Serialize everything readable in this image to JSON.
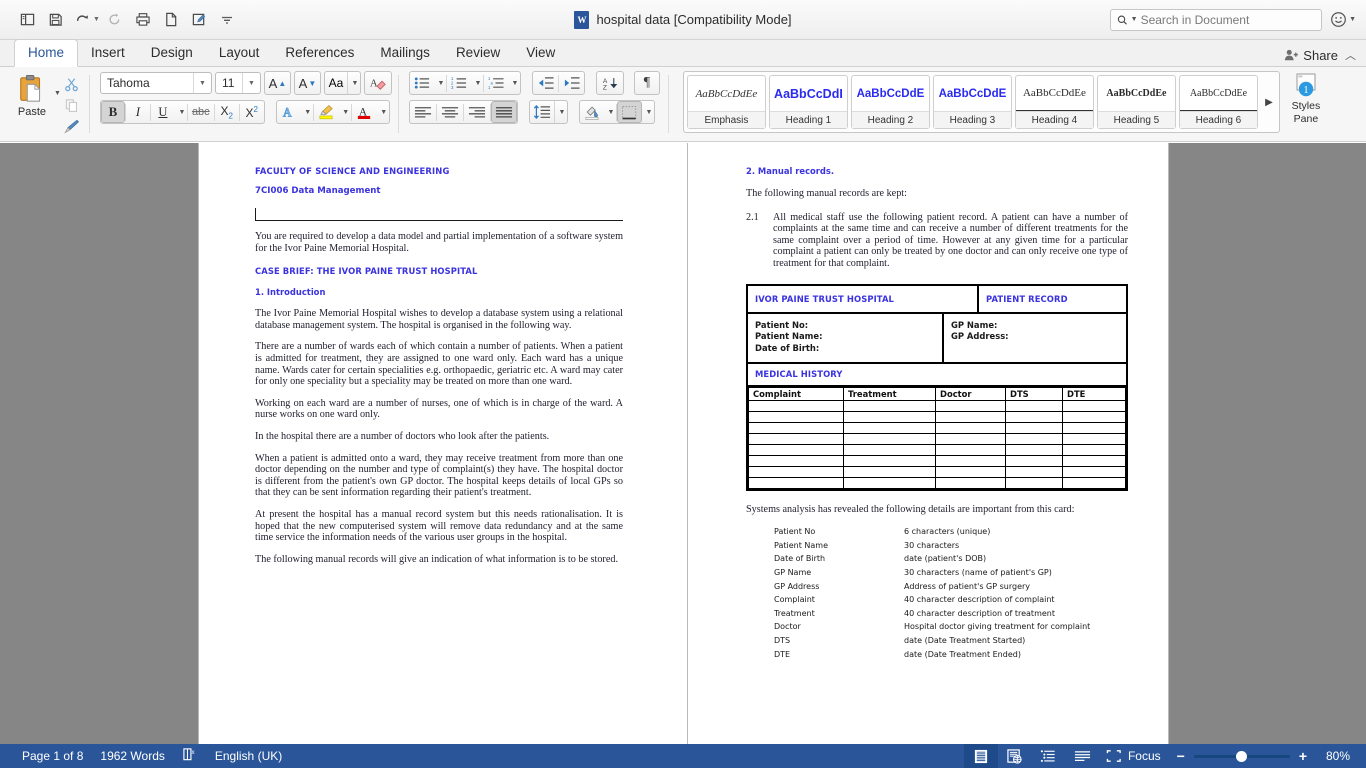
{
  "titlebar": {
    "document_title": "hospital data [Compatibility Mode]",
    "quick_access": [
      {
        "name": "sidebar-toggle",
        "icon": "panel-icon"
      },
      {
        "name": "save",
        "icon": "save-icon"
      },
      {
        "name": "undo",
        "icon": "undo-icon"
      },
      {
        "name": "redo",
        "icon": "redo-icon"
      },
      {
        "name": "print",
        "icon": "print-icon"
      },
      {
        "name": "new-document",
        "icon": "page-icon"
      },
      {
        "name": "edit",
        "icon": "pencil-page-icon"
      },
      {
        "name": "customize",
        "icon": "chevron-down-icon"
      }
    ],
    "search_placeholder": "Search in Document",
    "search_value": "",
    "feedback_icon": "smiley-icon"
  },
  "tabs": [
    {
      "label": "Home",
      "active": true
    },
    {
      "label": "Insert",
      "active": false
    },
    {
      "label": "Design",
      "active": false
    },
    {
      "label": "Layout",
      "active": false
    },
    {
      "label": "References",
      "active": false
    },
    {
      "label": "Mailings",
      "active": false
    },
    {
      "label": "Review",
      "active": false
    },
    {
      "label": "View",
      "active": false
    }
  ],
  "share": {
    "label": "Share",
    "icon": "person-plus-icon",
    "collapse_icon": "chevron-up-icon"
  },
  "ribbon": {
    "clipboard": {
      "paste_label": "Paste",
      "cut_name": "cut-icon",
      "copy_name": "copy-icon",
      "format_painter_name": "format-painter-icon"
    },
    "font": {
      "font_name": "Tahoma",
      "font_size": "11",
      "grow_font": "A",
      "shrink_font": "A",
      "change_case": "Aa",
      "clear_formatting": "clear-formatting-icon",
      "bold": "B",
      "italic": "I",
      "underline": "U",
      "strikethrough": "abc",
      "subscript": "X",
      "superscript": "X",
      "text_effects": "A",
      "highlight": "highlight-icon",
      "font_color": "A",
      "bold_active": true
    },
    "paragraph": {
      "bullets": "bullets-icon",
      "numbering": "numbering-icon",
      "multilevel": "multilevel-list-icon",
      "decrease_indent": "decrease-indent-icon",
      "increase_indent": "increase-indent-icon",
      "sort": "sort-icon",
      "show_marks": "¶",
      "align_left": "align-left-icon",
      "align_center": "align-center-icon",
      "align_right": "align-right-icon",
      "align_justify": "align-justify-icon",
      "line_spacing": "line-spacing-icon",
      "shading": "shading-icon",
      "borders": "borders-icon",
      "justify_active": true
    },
    "styles": {
      "items": [
        {
          "name": "Emphasis",
          "preview": "AaBbCcDdEe",
          "style": "emphasis"
        },
        {
          "name": "Heading 1",
          "preview": "AaBbCcDdI",
          "style": "h1"
        },
        {
          "name": "Heading 2",
          "preview": "AaBbCcDdE",
          "style": "h2"
        },
        {
          "name": "Heading 3",
          "preview": "AaBbCcDdE",
          "style": "h3"
        },
        {
          "name": "Heading 4",
          "preview": "AaBbCcDdEe",
          "style": "h4"
        },
        {
          "name": "Heading 5",
          "preview": "AaBbCcDdEe",
          "style": "h5"
        },
        {
          "name": "Heading 6",
          "preview": "AaBbCcDdEe",
          "style": "h6"
        }
      ],
      "more_icon": "chevron-right-icon",
      "pane_label_line1": "Styles",
      "pane_label_line2": "Pane",
      "pane_badge": "1"
    }
  },
  "document": {
    "page1": {
      "faculty": "FACULTY OF SCIENCE AND ENGINEERING",
      "module": "7CI006 Data Management",
      "intro": "You are required to develop a data model and partial implementation of a software system for the Ivor Paine Memorial Hospital.",
      "case_brief": "CASE BRIEF: THE IVOR PAINE TRUST HOSPITAL",
      "section1": "1. Introduction",
      "paragraphs": [
        "The Ivor Paine Memorial Hospital wishes to develop a database system using a relational database management system. The hospital is organised in the following way.",
        "There are a number of wards each of which contain a number of patients. When a patient is admitted for treatment, they are assigned to one ward only. Each ward has a unique name. Wards cater for certain specialities e.g. orthopaedic, geriatric etc. A ward may cater for only one speciality but a speciality may be treated on more than one ward.",
        "Working on each ward are a number of nurses, one of which is in charge of the ward. A nurse works on one ward only.",
        "In the hospital there are a number of doctors who look after the patients.",
        "When a patient is admitted onto a ward, they may receive treatment from more than one doctor depending on the number and type of complaint(s) they have. The hospital doctor is different from the patient's own GP doctor. The hospital keeps details of local GPs so that they can be sent information regarding their patient's treatment.",
        "At present the hospital has a manual record system but this needs rationalisation. It is hoped that the new computerised system will remove data redundancy and at the same time service the information needs of the various user groups in the hospital.",
        "The following manual records will give an indication of what information is to be stored."
      ]
    },
    "page2": {
      "section2": "2. Manual records.",
      "lead": "The following manual records are kept:",
      "clause_no": "2.1",
      "clause_text": "All medical staff use the following patient record. A patient can have a number of complaints at the same time and can receive a number of different treatments for the same complaint over a period of time. However at any given time for a particular complaint a patient can only be treated by one doctor and can only receive one type of treatment for that complaint.",
      "card": {
        "hospital_name": "IVOR PAINE TRUST HOSPITAL",
        "record_type": "PATIENT RECORD",
        "left_fields": [
          "Patient No:",
          "Patient Name:",
          "Date of Birth:"
        ],
        "right_fields": [
          "GP Name:",
          "GP Address:"
        ],
        "medical_history_title": "MEDICAL HISTORY",
        "columns": [
          "Complaint",
          "Treatment",
          "Doctor",
          "DTS",
          "DTE"
        ],
        "empty_rows": 8
      },
      "analysis_lead": "Systems analysis has revealed the following details are important from this card:",
      "definitions": [
        {
          "term": "Patient No",
          "desc": "6 characters (unique)"
        },
        {
          "term": "Patient Name",
          "desc": "30 characters"
        },
        {
          "term": "Date of Birth",
          "desc": "date (patient's DOB)"
        },
        {
          "term": "GP Name",
          "desc": "30 characters (name of patient's GP)"
        },
        {
          "term": "GP Address",
          "desc": "Address of patient's GP surgery"
        },
        {
          "term": "Complaint",
          "desc": "40 character description of complaint"
        },
        {
          "term": "Treatment",
          "desc": "40 character description of treatment"
        },
        {
          "term": "Doctor",
          "desc": "Hospital doctor giving treatment for complaint"
        },
        {
          "term": "DTS",
          "desc": "date (Date Treatment Started)"
        },
        {
          "term": "DTE",
          "desc": "date (Date Treatment Ended)"
        }
      ]
    }
  },
  "statusbar": {
    "page_count": "Page 1 of 8",
    "word_count": "1962 Words",
    "proofing_icon": "proofing-errors-icon",
    "language": "English (UK)",
    "views": [
      {
        "name": "print-layout-view",
        "icon": "print-layout-icon",
        "active": true
      },
      {
        "name": "web-layout-view",
        "icon": "web-layout-icon",
        "active": false
      },
      {
        "name": "outline-view",
        "icon": "outline-icon",
        "active": false
      },
      {
        "name": "draft-view",
        "icon": "draft-icon",
        "active": false
      }
    ],
    "focus_label": "Focus",
    "focus_icon": "focus-icon",
    "zoom_out": "−",
    "zoom_in": "+",
    "zoom_level": "80%"
  },
  "colors": {
    "heading_blue": "#3b33e0",
    "accent_blue": "#2b579a",
    "statusbar_blue": "#2a5699",
    "tab_active": "#2b579a"
  }
}
